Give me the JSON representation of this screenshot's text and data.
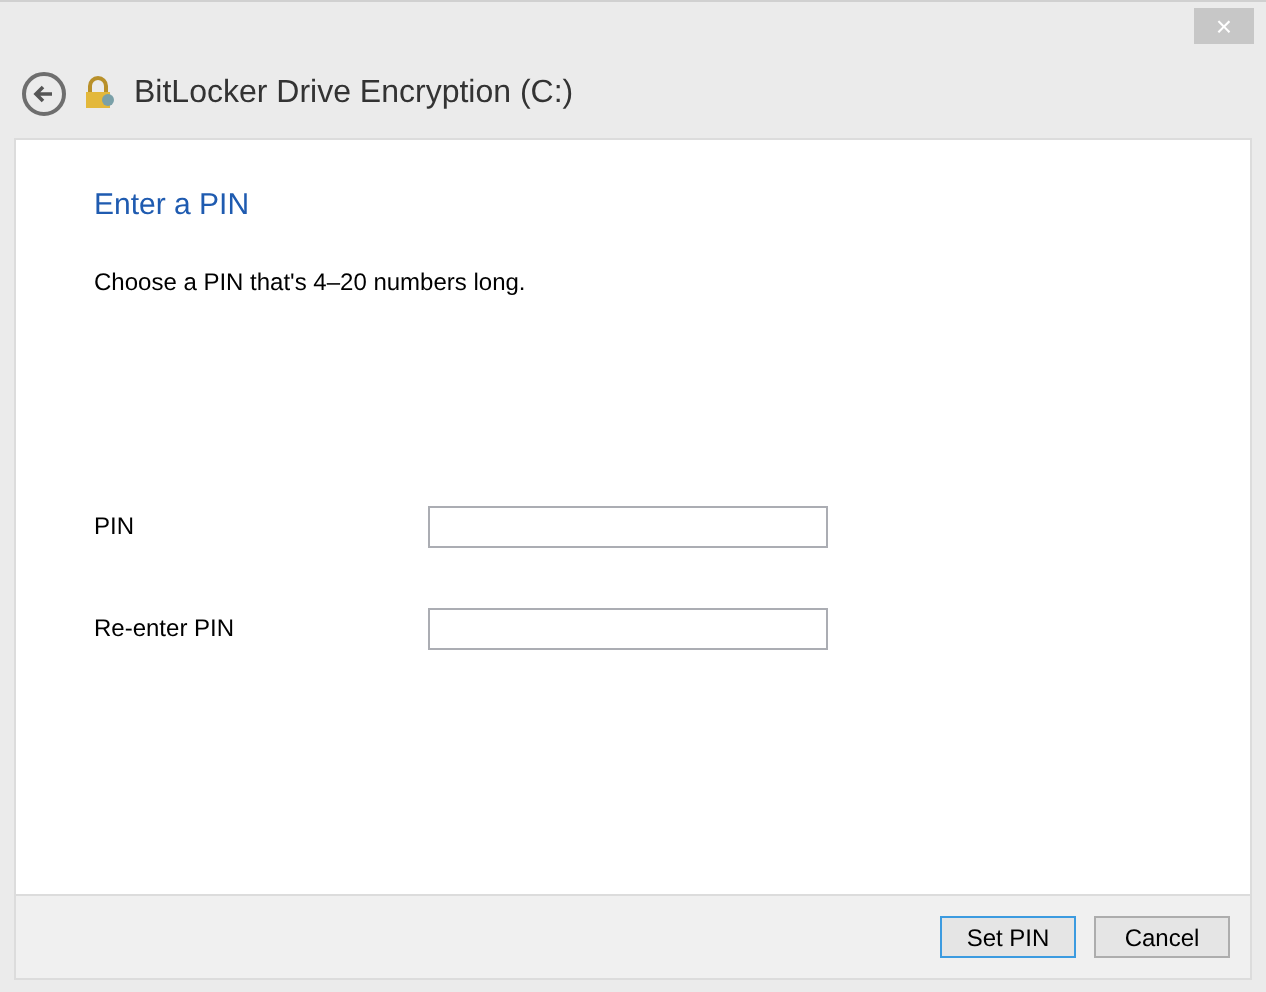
{
  "window": {
    "close": "×",
    "title": "BitLocker Drive Encryption (C:)"
  },
  "heading": "Enter a PIN",
  "description": "Choose a PIN that's 4–20 numbers long.",
  "fields": [
    {
      "label": "PIN"
    },
    {
      "label": "Re-enter PIN"
    }
  ],
  "buttons": [
    {
      "label": "Set PIN",
      "default": true
    },
    {
      "label": "Cancel",
      "default": false
    }
  ]
}
